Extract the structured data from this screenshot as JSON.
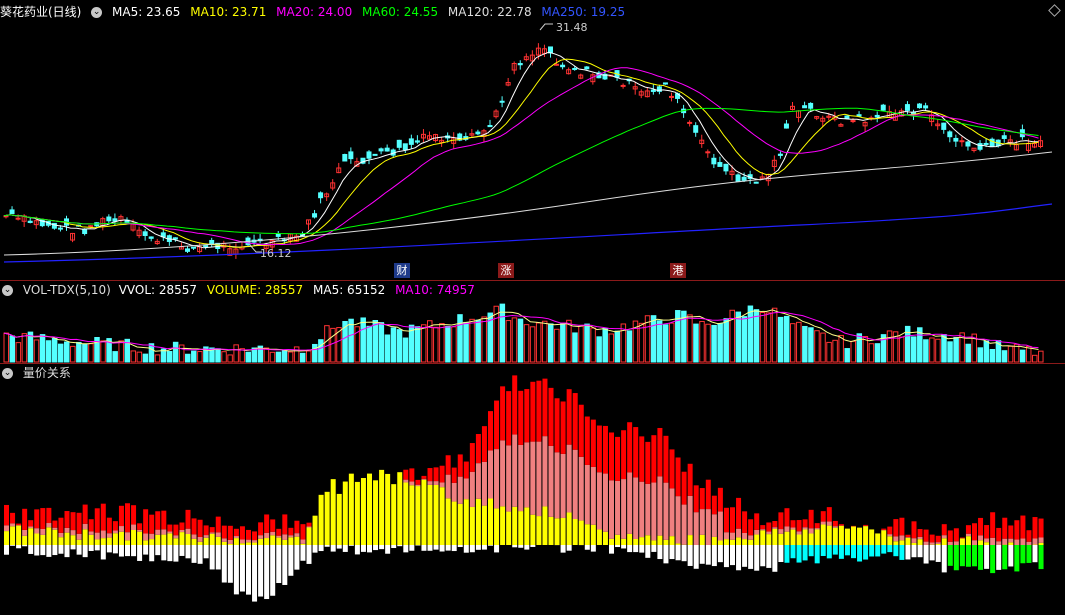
{
  "main_panel": {
    "title": "葵花药业(日线)",
    "indicators": [
      {
        "label": "MA5: 23.65",
        "color": "#ffffff"
      },
      {
        "label": "MA10: 23.71",
        "color": "#ffff00"
      },
      {
        "label": "MA20: 24.00",
        "color": "#ff00ff"
      },
      {
        "label": "MA60: 24.55",
        "color": "#00ff00"
      },
      {
        "label": "MA120: 22.78",
        "color": "#dddddd"
      },
      {
        "label": "MA250: 19.25",
        "color": "#3333ff"
      }
    ],
    "high_label": "31.48",
    "low_label": "16.12",
    "markers": [
      {
        "text": "财",
        "bg": "#1e3a8a"
      },
      {
        "text": "涨",
        "bg": "#8b1a1a"
      },
      {
        "text": "港",
        "bg": "#8b1a1a"
      }
    ]
  },
  "volume_panel": {
    "name": "VOL-TDX(5,10)",
    "indicators": [
      {
        "label": "VVOL: 28557",
        "color": "#ffffff"
      },
      {
        "label": "VOLUME: 28557",
        "color": "#ffff00"
      },
      {
        "label": "MA5: 65152",
        "color": "#ffffff"
      },
      {
        "label": "MA10: 74957",
        "color": "#ff00ff"
      }
    ]
  },
  "relation_panel": {
    "name": "量价关系"
  },
  "colors": {
    "up": "#ff3333",
    "down": "#54ffff",
    "ma5": "#ffffff",
    "ma10": "#ffff00",
    "ma20": "#ff00ff",
    "ma60": "#00ff00",
    "ma120": "#dddddd",
    "ma250": "#2222ff",
    "bar_red": "#ff0000",
    "bar_pink": "#f08080",
    "bar_yellow": "#ffff00",
    "bar_white": "#ffffff",
    "bar_cyan": "#00ffff",
    "bar_green": "#00ff00"
  }
}
